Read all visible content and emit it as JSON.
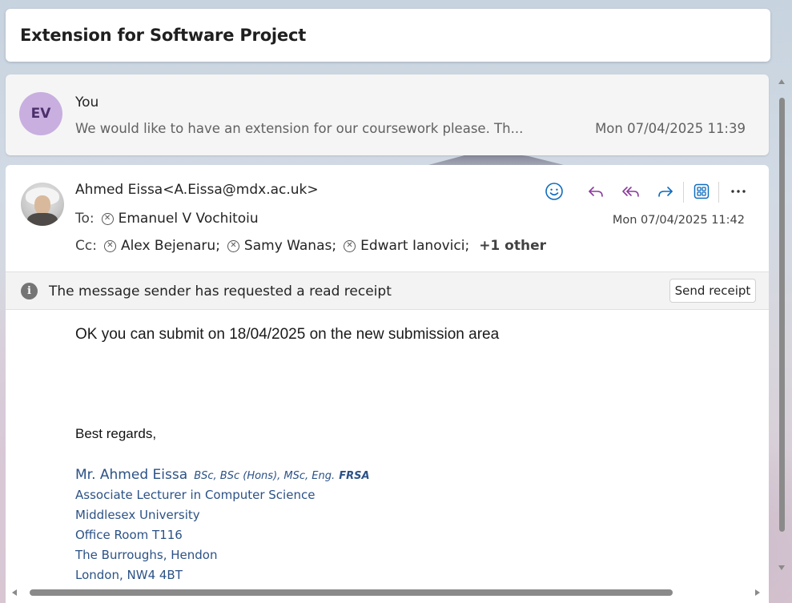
{
  "thread": {
    "subject": "Extension for Software Project"
  },
  "collapsed_message": {
    "avatar_initials": "EV",
    "sender": "You",
    "preview": "We would like to have an extension for our coursework please. Th...",
    "date": "Mon 07/04/2025 11:39"
  },
  "message": {
    "from": "Ahmed Eissa<A.Eissa@mdx.ac.uk>",
    "to_label": "To:",
    "to": [
      "Emanuel V Vochitoiu"
    ],
    "cc_label": "Cc:",
    "cc": [
      "Alex Bejenaru;",
      "Samy Wanas;",
      "Edwart Ianovici;"
    ],
    "cc_more": "+1 other",
    "date": "Mon 07/04/2025 11:42",
    "toolbar": {
      "icons": [
        "smiley-icon",
        "reply-icon",
        "reply-all-icon",
        "forward-icon",
        "apps-icon",
        "more-icon"
      ],
      "more_label": "···"
    },
    "read_receipt": {
      "text": "The message sender has requested a read receipt",
      "button": "Send receipt"
    },
    "body": "OK you can submit on 18/04/2025 on the new submission area",
    "closing": "Best regards,",
    "signature": {
      "name": "Mr. Ahmed Eissa",
      "qualifications": "BSc, BSc (Hons), MSc, Eng.",
      "fellowship": "FRSA",
      "lines": [
        "Associate Lecturer in Computer Science",
        "Middlesex University",
        "Office Room T116",
        "The Burroughs, Hendon",
        "London, NW4 4BT"
      ]
    }
  },
  "colors": {
    "accent_blue": "#0f6cbd",
    "purple_icons": "#8a3c9c",
    "signature_blue": "#2c5286",
    "avatar_bg": "#c8afe0"
  }
}
